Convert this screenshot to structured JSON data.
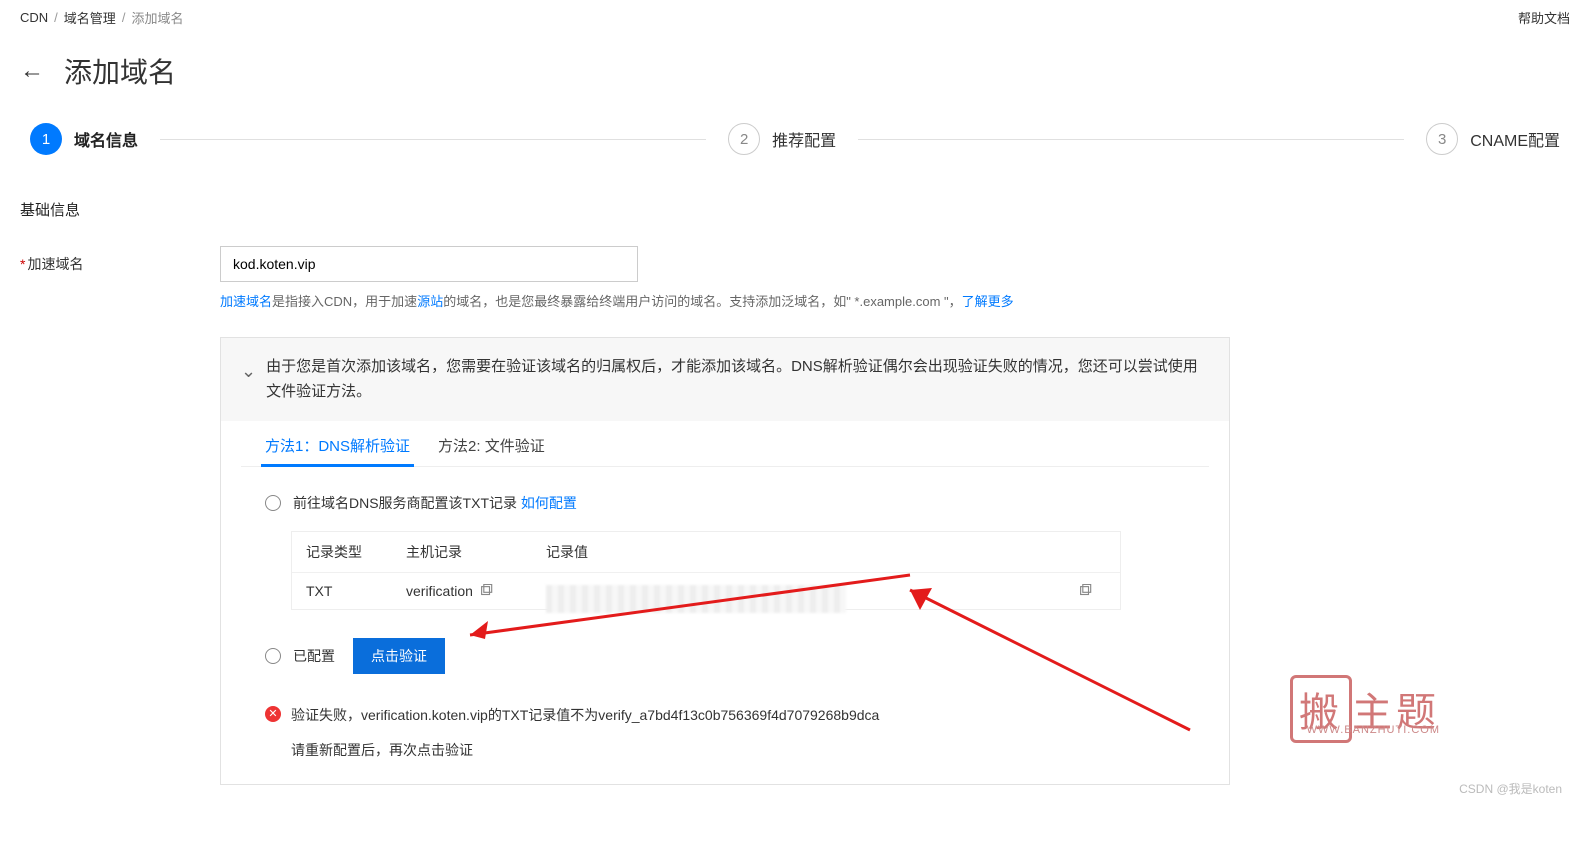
{
  "breadcrumb": {
    "root": "CDN",
    "mid": "域名管理",
    "cur": "添加域名",
    "help": "帮助文档"
  },
  "page_title": "添加域名",
  "steps": {
    "s1": {
      "num": "1",
      "label": "域名信息"
    },
    "s2": {
      "num": "2",
      "label": "推荐配置"
    },
    "s3": {
      "num": "3",
      "label": "CNAME配置"
    }
  },
  "section_basic": "基础信息",
  "form": {
    "domain_label": "加速域名",
    "domain_value": "kod.koten.vip",
    "helper_a": "加速域名",
    "helper_b": "是指接入CDN，用于加速",
    "helper_c": "源站",
    "helper_d": "的域名，也是您最终暴露给终端用户访问的域名。支持添加泛域名，如\" *.example.com \"，",
    "helper_e": "了解更多"
  },
  "verify": {
    "header": "由于您是首次添加该域名，您需要在验证该域名的归属权后，才能添加该域名。DNS解析验证偶尔会出现验证失败的情况，您还可以尝试使用文件验证方法。",
    "tabs": {
      "t1": "方法1：DNS解析验证",
      "t2": "方法2: 文件验证"
    },
    "opt1_a": "前往域名DNS服务商配置该TXT记录",
    "opt1_link": "如何配置",
    "table": {
      "h1": "记录类型",
      "h2": "主机记录",
      "h3": "记录值",
      "v1": "TXT",
      "v2": "verification"
    },
    "opt2": "已配置",
    "verify_btn": "点击验证",
    "err_text": "验证失败，verification.koten.vip的TXT记录值不为verify_a7bd4f13c0b756369f4d7079268b9dca",
    "err_sub": "请重新配置后，再次点击验证"
  },
  "watermark": {
    "main_a": "搬",
    "main_b": "主题",
    "sub": "WWW.BANZHUTI.COM"
  },
  "csdn": "CSDN @我是koten"
}
